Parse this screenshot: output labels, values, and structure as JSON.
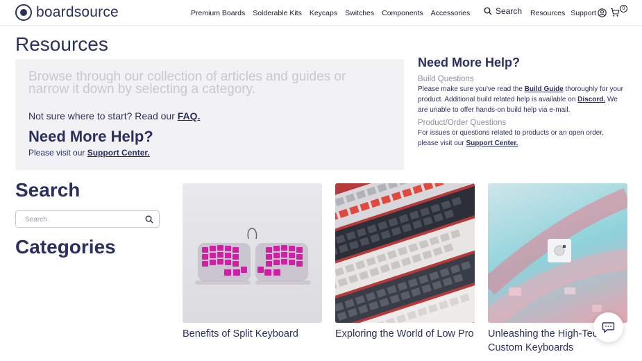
{
  "brand": {
    "name": "boardsource"
  },
  "nav": {
    "items": [
      "Premium Boards",
      "Solderable Kits",
      "Keycaps",
      "Switches",
      "Components",
      "Accessories"
    ]
  },
  "header": {
    "search_label": "Search",
    "resources": "Resources",
    "support": "Support",
    "cart_count": "0"
  },
  "page": {
    "title": "Resources"
  },
  "hero": {
    "intro": "Browse through our collection of articles and guides or narrow it down by selecting a category.",
    "faq_prefix": "Not sure where to start? Read our ",
    "faq_link": "FAQ.",
    "help_title": "Need More Help?",
    "help_prefix": "Please visit our ",
    "help_link": "Support Center."
  },
  "side": {
    "title": "Need More Help?",
    "build_heading": "Build Questions",
    "build_pre": "Please make sure you've read the ",
    "build_link": "Build Guide",
    "build_mid": " thoroughly for your product. Additional build related help is available on ",
    "build_link2": "Discord.",
    "build_post": " We are unable to offer hands-on build help via e-mail.",
    "order_heading": "Product/Order Questions",
    "order_pre": "For issues or questions related to products or an open order, please visit our ",
    "order_link": "Support Center."
  },
  "search": {
    "title": "Search",
    "placeholder": "Search"
  },
  "categories": {
    "title": "Categories"
  },
  "cards": [
    {
      "caption": "Benefits of Split Keyboard"
    },
    {
      "caption": "Exploring the World of Low Pro"
    },
    {
      "caption": "Unleashing the High-Tech of Custom Keyboards"
    }
  ],
  "icons": {
    "logo": "logo-mark-icon",
    "search": "search-icon",
    "user": "user-icon",
    "cart": "cart-icon",
    "chat": "chat-icon"
  },
  "colors": {
    "primary": "#2b2f5e",
    "muted": "#c7c8d0",
    "panel": "#f2f2f4"
  }
}
